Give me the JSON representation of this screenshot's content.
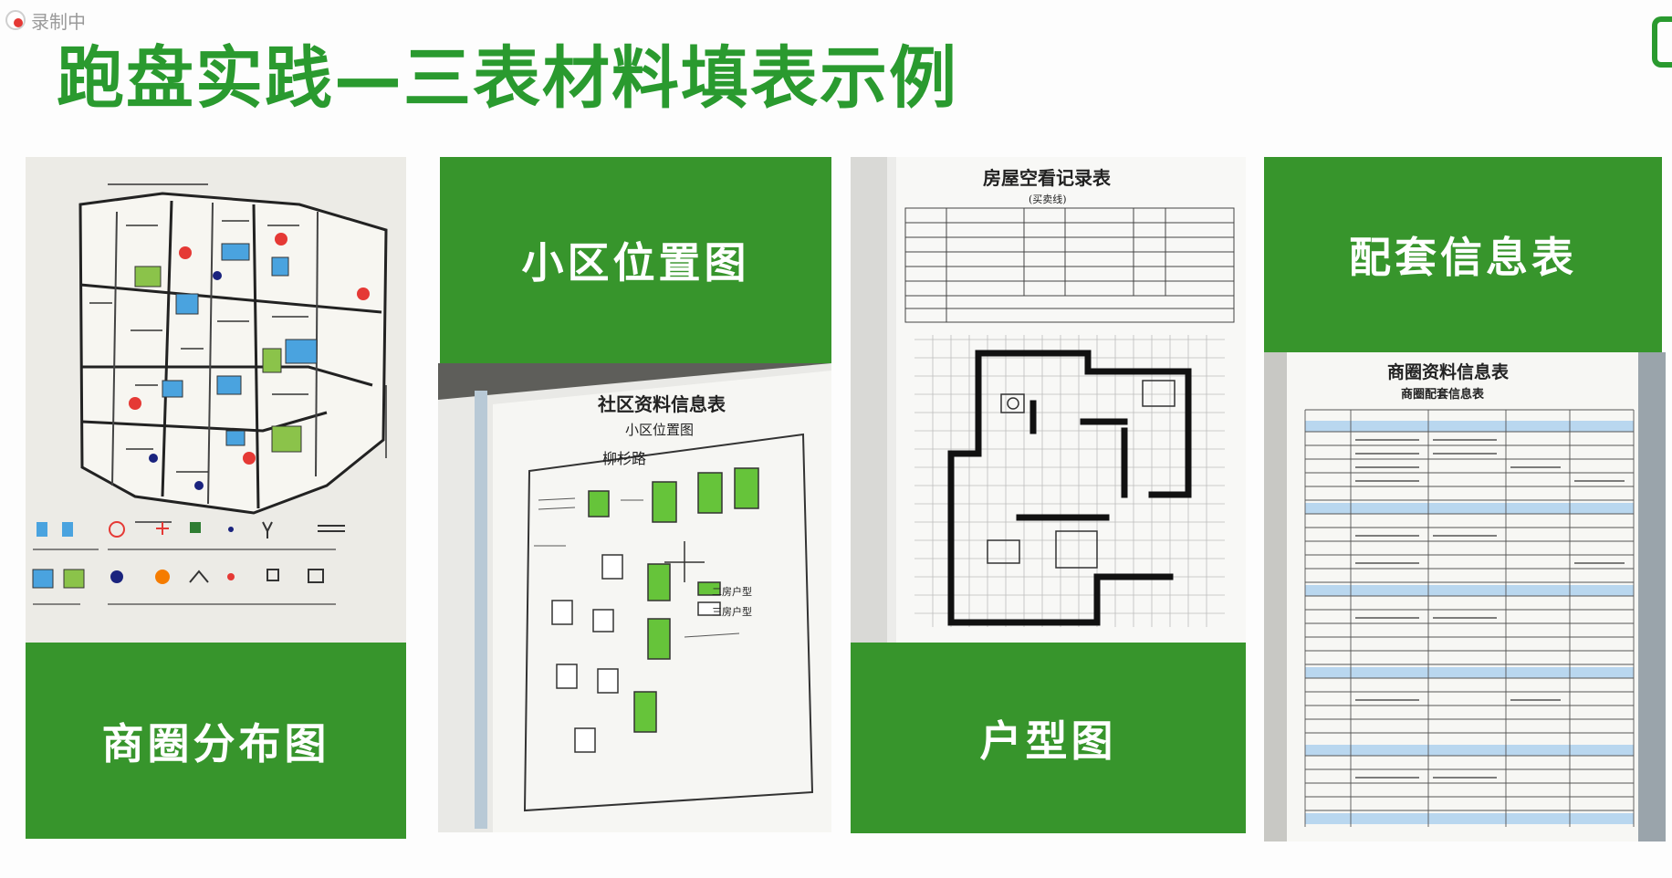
{
  "recording": {
    "label": "录制中"
  },
  "title": "跑盘实践—三表材料填表示例",
  "cards": {
    "business_map": {
      "label": "商圈分布图"
    },
    "location_map": {
      "label": "小区位置图"
    },
    "floor_plan": {
      "label": "户型图"
    },
    "facility_table": {
      "label": "配套信息表"
    }
  },
  "photos": {
    "community_sheet": {
      "heading": "社区资料信息表",
      "subheading": "小区位置图",
      "street": "柳杉路",
      "legend_a": "二房户型",
      "legend_b": "三房户型"
    },
    "house_record": {
      "heading": "房屋空看记录表",
      "subheading": "(买卖线)"
    },
    "commerce_sheet": {
      "heading": "商圈资料信息表",
      "subheading": "商圈配套信息表"
    }
  },
  "colors": {
    "title_green": "#2a9a2f",
    "block_green": "#37952c",
    "highlight_green": "#66c43a"
  },
  "icons": [
    "record-dot-icon",
    "home-icon"
  ]
}
